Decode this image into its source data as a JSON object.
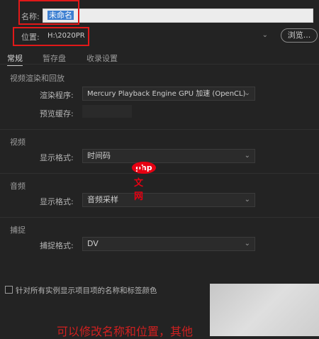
{
  "name_row": {
    "label": "名称:",
    "value": "未命名"
  },
  "location_row": {
    "label": "位置:",
    "value": "H:\\2020PR",
    "browse_label": "浏览..."
  },
  "tabs": [
    {
      "label": "常规",
      "active": true
    },
    {
      "label": "暂存盘",
      "active": false
    },
    {
      "label": "收录设置",
      "active": false
    }
  ],
  "video_rendering": {
    "section_title": "视频渲染和回放",
    "renderer_label": "渲染程序:",
    "renderer_value": "Mercury Playback Engine GPU 加速 (OpenCL)",
    "preview_cache_label": "预览缓存:"
  },
  "video": {
    "section_title": "视频",
    "display_format_label": "显示格式:",
    "display_format_value": "时间码"
  },
  "audio": {
    "section_title": "音频",
    "display_format_label": "显示格式:",
    "display_format_value": "音频采样"
  },
  "capture": {
    "section_title": "捕捉",
    "capture_format_label": "捕捉格式:",
    "capture_format_value": "DV"
  },
  "checkbox_label": "针对所有实例显示项目项的名称和标签颜色",
  "footer_note": "可以修改名称和位置，其他",
  "watermark": {
    "php": "php",
    "cn": "中文网"
  },
  "colors": {
    "background": "#232323",
    "highlight_red": "#e11919",
    "selection_blue": "#3d7fd1"
  }
}
